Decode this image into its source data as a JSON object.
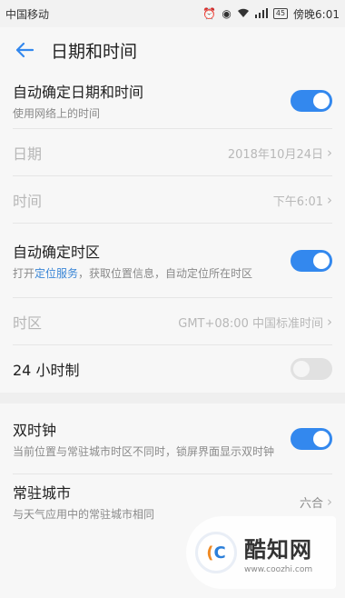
{
  "status_bar": {
    "carrier": "中国移动",
    "battery": "45",
    "time": "傍晚6:01"
  },
  "header": {
    "title": "日期和时间"
  },
  "settings": {
    "auto_datetime": {
      "label": "自动确定日期和时间",
      "sub": "使用网络上的时间",
      "on": true
    },
    "date": {
      "label": "日期",
      "value": "2018年10月24日"
    },
    "time": {
      "label": "时间",
      "value": "下午6:01"
    },
    "auto_timezone": {
      "label": "自动确定时区",
      "sub_prefix": "打开",
      "sub_link": "定位服务",
      "sub_suffix": "，获取位置信息，自动定位所在时区",
      "on": true
    },
    "timezone": {
      "label": "时区",
      "value": "GMT+08:00 中国标准时间"
    },
    "hour24": {
      "label": "24 小时制",
      "on": false
    },
    "dual_clock": {
      "label": "双时钟",
      "sub": "当前位置与常驻城市时区不同时，锁屏界面显示双时钟",
      "on": true
    },
    "home_city": {
      "label": "常驻城市",
      "sub": "与天气应用中的常驻城市相同",
      "value": "六合"
    }
  },
  "watermark": {
    "name": "酷知网",
    "url": "www.coozhi.com"
  },
  "colors": {
    "accent": "#3388ee",
    "link": "#3a86d6"
  }
}
